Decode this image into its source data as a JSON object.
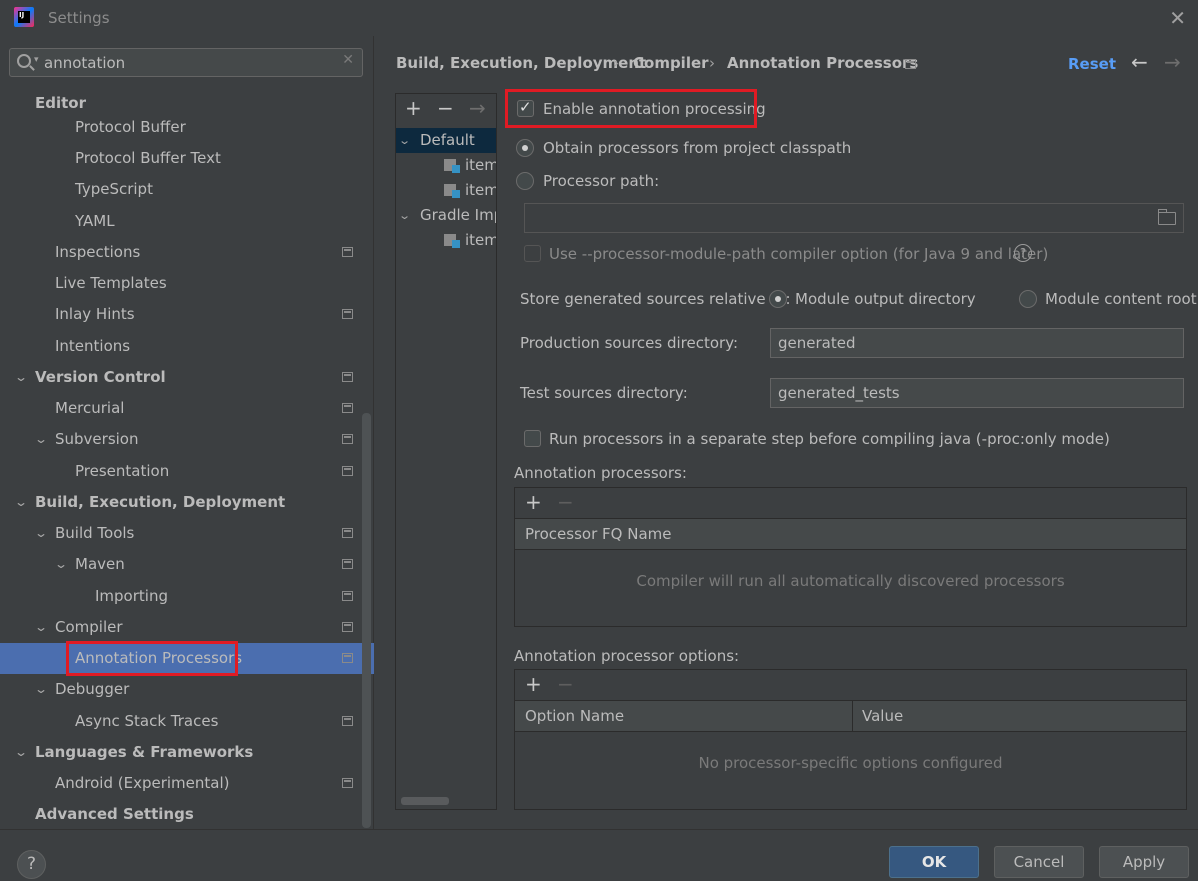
{
  "window": {
    "title": "Settings",
    "logo_text": "IJ"
  },
  "search": {
    "value": "annotation",
    "placeholder": ""
  },
  "sidebar": {
    "items": [
      {
        "label": "Editor"
      },
      {
        "label": "Protocol Buffer"
      },
      {
        "label": "Protocol Buffer Text"
      },
      {
        "label": "TypeScript"
      },
      {
        "label": "YAML"
      },
      {
        "label": "Inspections"
      },
      {
        "label": "Live Templates"
      },
      {
        "label": "Inlay Hints"
      },
      {
        "label": "Intentions"
      },
      {
        "label": "Version Control"
      },
      {
        "label": "Mercurial"
      },
      {
        "label": "Subversion"
      },
      {
        "label": "Presentation"
      },
      {
        "label": "Build, Execution, Deployment"
      },
      {
        "label": "Build Tools"
      },
      {
        "label": "Maven"
      },
      {
        "label": "Importing"
      },
      {
        "label": "Compiler"
      },
      {
        "label": "Annotation Processors"
      },
      {
        "label": "Debugger"
      },
      {
        "label": "Async Stack Traces"
      },
      {
        "label": "Languages & Frameworks"
      },
      {
        "label": "Android (Experimental)"
      },
      {
        "label": "Advanced Settings"
      }
    ]
  },
  "breadcrumb": {
    "parts": [
      "Build, Execution, Deployment",
      "Compiler",
      "Annotation Processors"
    ],
    "separator": "›"
  },
  "header": {
    "reset_label": "Reset",
    "back_icon": "←",
    "forward_icon": "→"
  },
  "profiles": {
    "toolbar": {
      "add": "+",
      "remove": "−",
      "move": "→"
    },
    "items": [
      {
        "label": "Default"
      },
      {
        "label": "item"
      },
      {
        "label": "item"
      },
      {
        "label": "Gradle Imp"
      },
      {
        "label": "item"
      }
    ]
  },
  "options": {
    "enable_label": "Enable annotation processing",
    "enable_checked": true,
    "obtain_label": "Obtain processors from project classpath",
    "processor_path_label": "Processor path:",
    "processor_path_value": "",
    "module_path_label": "Use --processor-module-path compiler option (for Java 9 and later)",
    "help_glyph": "?",
    "store_label": "Store generated sources relative to:",
    "module_output_label": "Module output directory",
    "module_content_label": "Module content root",
    "production_label": "Production sources directory:",
    "production_value": "generated",
    "test_label": "Test sources directory:",
    "test_value": "generated_tests",
    "run_separate_label": "Run processors in a separate step before compiling java (-proc:only mode)"
  },
  "processors_table": {
    "title": "Annotation processors:",
    "add": "+",
    "remove": "−",
    "column": "Processor FQ Name",
    "empty_text": "Compiler will run all automatically discovered processors"
  },
  "options_table": {
    "title": "Annotation processor options:",
    "add": "+",
    "remove": "−",
    "columns": [
      "Option Name",
      "Value"
    ],
    "empty_text": "No processor-specific options configured"
  },
  "footer": {
    "help": "?",
    "ok": "OK",
    "cancel": "Cancel",
    "apply": "Apply"
  },
  "colors": {
    "background": "#3c3f41",
    "selection": "#4b6eaf",
    "accent_link": "#589df6",
    "highlight_box": "#e01b24",
    "primary_button": "#365880"
  }
}
